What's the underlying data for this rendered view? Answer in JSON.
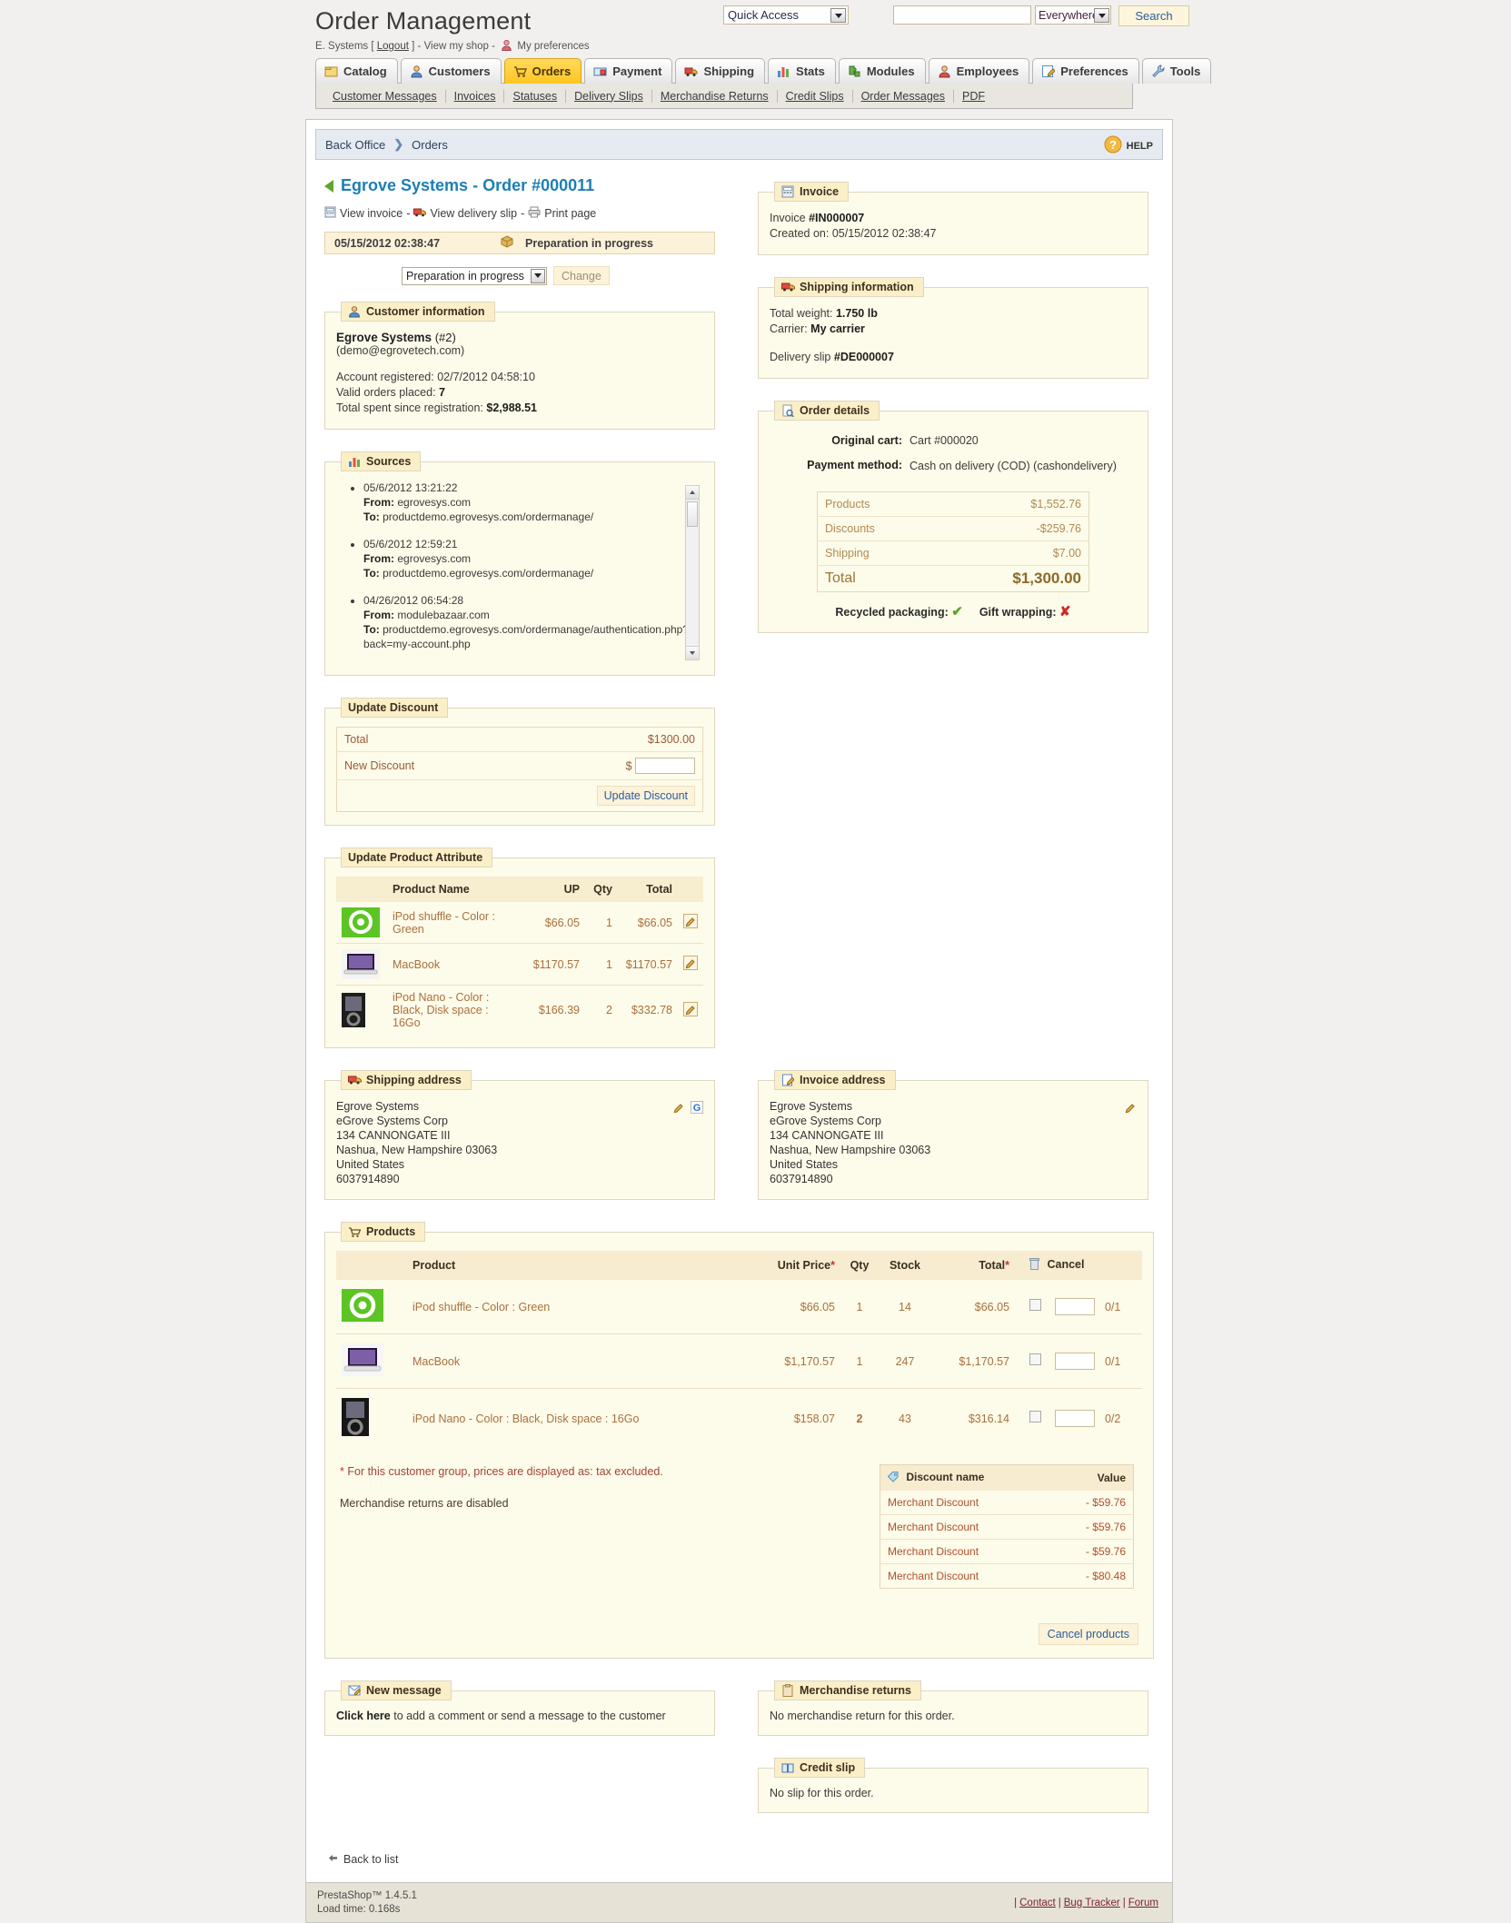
{
  "header": {
    "app_title": "Order Management",
    "user_name": "E. Systems",
    "logout_label": "Logout",
    "view_shop_label": "View my shop",
    "preferences_label": "My preferences",
    "quick_access_label": "Quick Access",
    "search_value": "",
    "search_placeholder": "",
    "search_scope": "Everywhere",
    "search_button": "Search"
  },
  "tabs": [
    {
      "label": "Catalog",
      "icon": "folder-icon",
      "active": false
    },
    {
      "label": "Customers",
      "icon": "user-icon",
      "active": false
    },
    {
      "label": "Orders",
      "icon": "cart-icon",
      "active": true
    },
    {
      "label": "Payment",
      "icon": "payment-icon",
      "active": false
    },
    {
      "label": "Shipping",
      "icon": "truck-icon",
      "active": false
    },
    {
      "label": "Stats",
      "icon": "chart-icon",
      "active": false
    },
    {
      "label": "Modules",
      "icon": "puzzle-icon",
      "active": false
    },
    {
      "label": "Employees",
      "icon": "employee-icon",
      "active": false
    },
    {
      "label": "Preferences",
      "icon": "note-icon",
      "active": false
    },
    {
      "label": "Tools",
      "icon": "wrench-icon",
      "active": false
    }
  ],
  "subnav": [
    "Customer Messages",
    "Invoices",
    "Statuses",
    "Delivery Slips",
    "Merchandise Returns",
    "Credit Slips",
    "Order Messages",
    "PDF"
  ],
  "breadcrumb": {
    "root": "Back Office",
    "current": "Orders",
    "help_label": "HELP"
  },
  "order": {
    "title": "Egrove Systems - Order #000011",
    "links": [
      "View invoice",
      "View delivery slip",
      "Print page"
    ],
    "status_date": "05/15/2012 02:38:47",
    "status_label": "Preparation in progress",
    "status_select": "Preparation in progress",
    "change_button": "Change"
  },
  "customer": {
    "panel_title": "Customer information",
    "name": "Egrove Systems",
    "id": "(#2)",
    "email": "(demo@egrovetech.com)",
    "registered_label": "Account registered:",
    "registered_value": "02/7/2012 04:58:10",
    "valid_orders_label": "Valid orders placed:",
    "valid_orders_value": "7",
    "total_spent_label": "Total spent since registration:",
    "total_spent_value": "$2,988.51"
  },
  "sources": {
    "panel_title": "Sources",
    "items": [
      {
        "date": "05/6/2012 13:21:22",
        "from_label": "From:",
        "from": "egrovesys.com",
        "to_label": "To:",
        "to": "productdemo.egrovesys.com/ordermanage/"
      },
      {
        "date": "05/6/2012 12:59:21",
        "from_label": "From:",
        "from": "egrovesys.com",
        "to_label": "To:",
        "to": "productdemo.egrovesys.com/ordermanage/"
      },
      {
        "date": "04/26/2012 06:54:28",
        "from_label": "From:",
        "from": "modulebazaar.com",
        "to_label": "To:",
        "to": "productdemo.egrovesys.com/ordermanage/authentication.php?back=my-account.php"
      }
    ]
  },
  "update_discount": {
    "panel_title": "Update Discount",
    "total_label": "Total",
    "total_value": "$1300.00",
    "new_discount_label": "New Discount",
    "currency_symbol": "$",
    "new_discount_value": "",
    "button": "Update Discount"
  },
  "update_product_attribute": {
    "panel_title": "Update Product Attribute",
    "columns": [
      "",
      "Product Name",
      "UP",
      "Qty",
      "Total",
      ""
    ],
    "rows": [
      {
        "thumb": "ipod-shuffle-green-thumb",
        "name": "iPod shuffle - Color : Green",
        "up": "$66.05",
        "qty": "1",
        "total": "$66.05",
        "action": "edit-icon"
      },
      {
        "thumb": "macbook-thumb",
        "name": "MacBook",
        "up": "$1170.57",
        "qty": "1",
        "total": "$1170.57",
        "action": "edit-icon"
      },
      {
        "thumb": "ipod-nano-black-thumb",
        "name": "iPod Nano - Color : Black, Disk space : 16Go",
        "up": "$166.39",
        "qty": "2",
        "total": "$332.78",
        "action": "edit-icon"
      }
    ]
  },
  "invoice": {
    "panel_title": "Invoice",
    "invoice_label": "Invoice",
    "invoice_number": "#IN000007",
    "created_label": "Created on:",
    "created_value": "05/15/2012 02:38:47"
  },
  "shipping_info": {
    "panel_title": "Shipping information",
    "weight_label": "Total weight:",
    "weight_value": "1.750 lb",
    "carrier_label": "Carrier:",
    "carrier_value": "My carrier",
    "slip_label": "Delivery slip",
    "slip_value": "#DE000007"
  },
  "order_details": {
    "panel_title": "Order details",
    "cart_label": "Original cart:",
    "cart_value": "Cart #000020",
    "payment_label": "Payment method:",
    "payment_value": "Cash on delivery (COD) (cashondelivery)",
    "rows": [
      {
        "label": "Products",
        "value": "$1,552.76"
      },
      {
        "label": "Discounts",
        "value": "-$259.76"
      },
      {
        "label": "Shipping",
        "value": "$7.00"
      }
    ],
    "total_label": "Total",
    "total_value": "$1,300.00",
    "recycled_label": "Recycled packaging:",
    "recycled_value": true,
    "gift_label": "Gift wrapping:",
    "gift_value": false
  },
  "shipping_address": {
    "panel_title": "Shipping address",
    "lines": [
      "Egrove Systems",
      "eGrove Systems Corp",
      "134 CANNONGATE III",
      "Nashua, New Hampshire 03063",
      "United States",
      "6037914890"
    ],
    "actions": [
      "edit-icon",
      "google-maps-icon"
    ]
  },
  "invoice_address": {
    "panel_title": "Invoice address",
    "lines": [
      "Egrove Systems",
      "eGrove Systems Corp",
      "134 CANNONGATE III",
      "Nashua, New Hampshire 03063",
      "United States",
      "6037914890"
    ],
    "actions": [
      "edit-icon"
    ]
  },
  "products": {
    "panel_title": "Products",
    "columns": [
      "",
      "Product",
      "Unit Price",
      "Qty",
      "Stock",
      "Total",
      "Cancel"
    ],
    "unit_price_star": "*",
    "total_star": "*",
    "rows": [
      {
        "thumb": "ipod-shuffle-green-thumb",
        "name": "iPod shuffle - Color : Green",
        "unit_price": "$66.05",
        "qty": "1",
        "qty_highlight": false,
        "stock": "14",
        "total": "$66.05",
        "cancel_value": "",
        "ratio": "0/1"
      },
      {
        "thumb": "macbook-thumb",
        "name": "MacBook",
        "unit_price": "$1,170.57",
        "qty": "1",
        "qty_highlight": false,
        "stock": "247",
        "total": "$1,170.57",
        "cancel_value": "",
        "ratio": "0/1"
      },
      {
        "thumb": "ipod-nano-black-thumb",
        "name": "iPod Nano - Color : Black, Disk space : 16Go",
        "unit_price": "$158.07",
        "qty": "2",
        "qty_highlight": true,
        "stock": "43",
        "total": "$316.14",
        "cancel_value": "",
        "ratio": "0/2"
      }
    ],
    "note_star": "*",
    "note_text": "For this customer group, prices are displayed as: tax excluded.",
    "note2": "Merchandise returns are disabled",
    "cancel_button": "Cancel products"
  },
  "discount_names": {
    "col_name": "Discount name",
    "col_value": "Value",
    "rows": [
      {
        "name": "Merchant Discount",
        "value": "- $59.76"
      },
      {
        "name": "Merchant Discount",
        "value": "- $59.76"
      },
      {
        "name": "Merchant Discount",
        "value": "- $59.76"
      },
      {
        "name": "Merchant Discount",
        "value": "- $80.48"
      }
    ]
  },
  "new_message": {
    "panel_title": "New message",
    "link_text": "Click here",
    "rest_text": " to add a comment or send a message to the customer"
  },
  "merchandise_returns": {
    "panel_title": "Merchandise returns",
    "text": "No merchandise return for this order."
  },
  "credit_slip": {
    "panel_title": "Credit slip",
    "text": "No slip for this order."
  },
  "back_to_list": "Back to list",
  "footer": {
    "product": "PrestaShop™ 1.4.5.1",
    "load_time": "Load time: 0.168s",
    "links": [
      "Contact",
      "Bug Tracker",
      "Forum"
    ]
  }
}
